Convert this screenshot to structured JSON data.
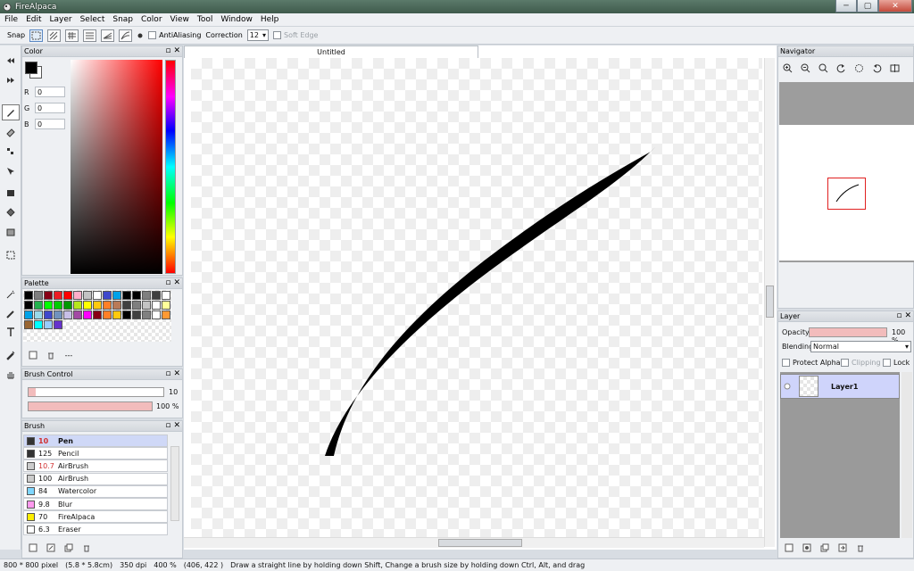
{
  "window": {
    "title": "FireAlpaca",
    "minimize": "─",
    "maximize": "▢",
    "close": "✕"
  },
  "menu": [
    "File",
    "Edit",
    "Layer",
    "Select",
    "Snap",
    "Color",
    "View",
    "Tool",
    "Window",
    "Help"
  ],
  "toolbar": {
    "snap_label": "Snap",
    "antialiasing_label": "AntiAliasing",
    "correction_label": "Correction",
    "correction_value": "12",
    "soft_edge_label": "Soft Edge"
  },
  "color_panel": {
    "title": "Color",
    "r_label": "R",
    "r_value": "0",
    "g_label": "G",
    "g_value": "0",
    "b_label": "B",
    "b_value": "0",
    "primary": "#000000",
    "secondary": "#ffffff"
  },
  "palette_panel": {
    "title": "Palette",
    "swatches": [
      "#000000",
      "#7f7f7f",
      "#880015",
      "#ed1c24",
      "#ff0000",
      "#ffaec9",
      "#c3c3c3",
      "#ffffff",
      "#3f48cc",
      "#00a2e8",
      "#000000",
      "#000000",
      "#7f7f7f",
      "#404040",
      "#ffffff",
      "#000000",
      "#22b14c",
      "#00ff00",
      "#00cc00",
      "#009900",
      "#b5e61d",
      "#ffff00",
      "#ffc90e",
      "#ff7f27",
      "#b97a57",
      "#404040",
      "#7f7f7f",
      "#c3c3c3",
      "#ffffff",
      "#ffff99",
      "#00a2e8",
      "#99d9ea",
      "#3f48cc",
      "#7092be",
      "#c8bfe7",
      "#a349a4",
      "#ff00ff",
      "#880015",
      "#ff7f27",
      "#ffc90e",
      "#000000",
      "#404040",
      "#808080",
      "#ffffff",
      "#ff9933",
      "#996633",
      "#00ffff",
      "#99ccff",
      "#6633cc"
    ],
    "footer_text": "---"
  },
  "brush_control": {
    "title": "Brush Control",
    "size_value": "10",
    "size_fraction": 0.05,
    "opacity_value": "100 %",
    "opacity_fraction": 1.0
  },
  "brush_panel": {
    "title": "Brush",
    "brushes": [
      {
        "size": "10",
        "name": "Pen",
        "color": "#333333",
        "selected": true
      },
      {
        "size": "125",
        "name": "Pencil",
        "color": "#333333",
        "selected": false
      },
      {
        "size": "10.7",
        "name": "AirBrush",
        "color": "#cccccc",
        "selected": false
      },
      {
        "size": "100",
        "name": "AirBrush",
        "color": "#cccccc",
        "selected": false
      },
      {
        "size": "84",
        "name": "Watercolor",
        "color": "#7fd6ff",
        "selected": false
      },
      {
        "size": "9.8",
        "name": "Blur",
        "color": "#ff99ee",
        "selected": false
      },
      {
        "size": "70",
        "name": "FireAlpaca",
        "color": "#ffee00",
        "selected": false
      },
      {
        "size": "6.3",
        "name": "Eraser",
        "color": "#ffffff",
        "selected": false
      }
    ]
  },
  "document": {
    "tab_title": "Untitled"
  },
  "navigator": {
    "title": "Navigator"
  },
  "layer_panel": {
    "title": "Layer",
    "opacity_label": "Opacity",
    "opacity_value": "100 %",
    "blending_label": "Blending",
    "blending_value": "Normal",
    "protect_alpha_label": "Protect Alpha",
    "clipping_label": "Clipping",
    "lock_label": "Lock",
    "layers": [
      {
        "name": "Layer1"
      }
    ]
  },
  "status": {
    "size": "800 * 800 pixel",
    "physical": "(5.8 * 5.8cm)",
    "dpi": "350 dpi",
    "zoom": "400 %",
    "coords": "(406, 422 )",
    "hint": "Draw a straight line by holding down Shift, Change a brush size by holding down Ctrl, Alt, and drag"
  },
  "colors": {
    "accent_pink": "#f2bcbc",
    "selection_blue": "#cfd4fb",
    "nav_frame": "#e02020"
  }
}
